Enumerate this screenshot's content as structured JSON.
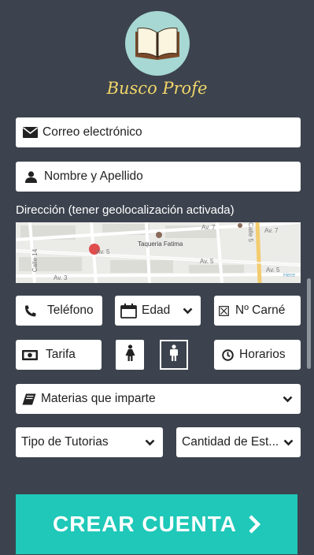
{
  "brand": {
    "name": "Busco Profe"
  },
  "form": {
    "email_placeholder": "Correo electrónico",
    "name_placeholder": "Nombre y Apellido",
    "address_label": "Dirección (tener geolocalización activada)",
    "phone_label": "Teléfono",
    "age_label": "Edad",
    "card_label": "Nº Carné",
    "rate_label": "Tarifa",
    "hours_label": "Horarios",
    "subjects_label": "Materias que imparte",
    "tutoring_type_label": "Tipo de Tutorias",
    "student_count_label": "Cantidad de Est..."
  },
  "map": {
    "place_label": "Taqueria Fatima",
    "streets": [
      "Av. 7",
      "Av. 7",
      "Av. 5",
      "Av. 5",
      "Av. 5",
      "Av. 3",
      "Calle 14",
      "Calle 5"
    ],
    "watermark": "Here"
  },
  "cta": {
    "label": "CREAR CUENTA"
  },
  "colors": {
    "background": "#3c434e",
    "accent": "#1fc8b8",
    "brand": "#f2d66a",
    "logo_circle": "#a7d8d3",
    "map_pin": "#e04d4d"
  }
}
